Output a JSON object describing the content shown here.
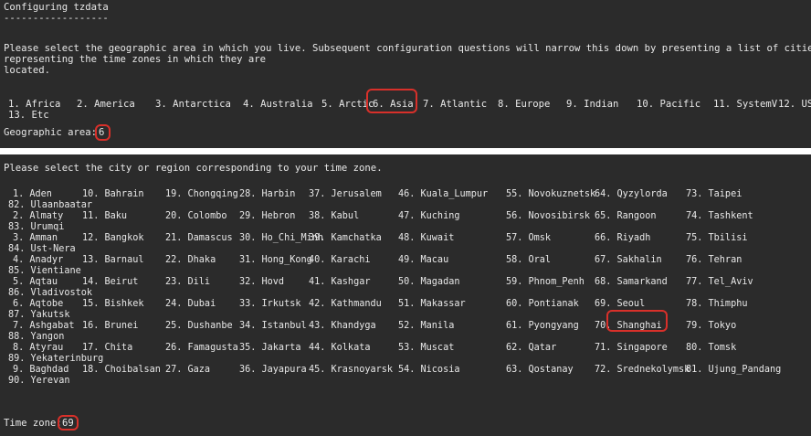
{
  "window1": {
    "title": "Configuring tzdata",
    "separator": "------------------",
    "prompt_line1": "Please select the geographic area in which you live. Subsequent configuration questions will narrow this down by presenting a list of cities,",
    "prompt_line2": "representing the time zones in which they are",
    "prompt_line3": "located.",
    "areas": [
      {
        "num": "1.",
        "name": "Africa"
      },
      {
        "num": "2.",
        "name": "America"
      },
      {
        "num": "3.",
        "name": "Antarctica"
      },
      {
        "num": "4.",
        "name": "Australia"
      },
      {
        "num": "5.",
        "name": "Arctic"
      },
      {
        "num": "6.",
        "name": "Asia"
      },
      {
        "num": "7.",
        "name": "Atlantic"
      },
      {
        "num": "8.",
        "name": "Europe"
      },
      {
        "num": "9.",
        "name": "Indian"
      },
      {
        "num": "10.",
        "name": "Pacific"
      },
      {
        "num": "11.",
        "name": "SystemV"
      },
      {
        "num": "12.",
        "name": "US"
      },
      {
        "num": "13.",
        "name": "Etc"
      }
    ],
    "input_label": "Geographic area:",
    "input_value": "6"
  },
  "window2": {
    "prompt": "Please select the city or region corresponding to your time zone.",
    "cities": [
      [
        "1. Aden",
        "10. Bahrain",
        "19. Chongqing",
        "28. Harbin",
        "37. Jerusalem",
        "46. Kuala_Lumpur",
        "55. Novokuznetsk",
        "64. Qyzylorda",
        "73. Taipei"
      ],
      [
        "2. Almaty",
        "11. Baku",
        "20. Colombo",
        "29. Hebron",
        "38. Kabul",
        "47. Kuching",
        "56. Novosibirsk",
        "65. Rangoon",
        "74. Tashkent"
      ],
      [
        "3. Amman",
        "12. Bangkok",
        "21. Damascus",
        "30. Ho_Chi_Minh",
        "39. Kamchatka",
        "48. Kuwait",
        "57. Omsk",
        "66. Riyadh",
        "75. Tbilisi"
      ],
      [
        "4. Anadyr",
        "13. Barnaul",
        "22. Dhaka",
        "31. Hong_Kong",
        "40. Karachi",
        "49. Macau",
        "58. Oral",
        "67. Sakhalin",
        "76. Tehran"
      ],
      [
        "5. Aqtau",
        "14. Beirut",
        "23. Dili",
        "32. Hovd",
        "41. Kashgar",
        "50. Magadan",
        "59. Phnom_Penh",
        "68. Samarkand",
        "77. Tel_Aviv"
      ],
      [
        "6. Aqtobe",
        "15. Bishkek",
        "24. Dubai",
        "33. Irkutsk",
        "42. Kathmandu",
        "51. Makassar",
        "60. Pontianak",
        "69. Seoul",
        "78. Thimphu"
      ],
      [
        "7. Ashgabat",
        "16. Brunei",
        "25. Dushanbe",
        "34. Istanbul",
        "43. Khandyga",
        "52. Manila",
        "61. Pyongyang",
        "70. Shanghai",
        "79. Tokyo"
      ],
      [
        "8. Atyrau",
        "17. Chita",
        "26. Famagusta",
        "35. Jakarta",
        "44. Kolkata",
        "53. Muscat",
        "62. Qatar",
        "71. Singapore",
        "80. Tomsk"
      ],
      [
        "9. Baghdad",
        "18. Choibalsan",
        "27. Gaza",
        "36. Jayapura",
        "45. Krasnoyarsk",
        "54. Nicosia",
        "63. Qostanay",
        "72. Srednekolymsk",
        "81. Ujung_Pandang"
      ]
    ],
    "overflow": [
      "82. Ulaanbaatar",
      "83. Urumqi",
      "84. Ust-Nera",
      "85. Vientiane",
      "86. Vladivostok",
      "87. Yakutsk",
      "88. Yangon",
      "89. Yekaterinburg",
      "90. Yerevan"
    ],
    "input_label": "Time zone:",
    "input_value": "69"
  },
  "colors": {
    "terminal_bg": "#2b2b2b",
    "text": "#e8e8e8",
    "highlight": "#d8302a"
  }
}
